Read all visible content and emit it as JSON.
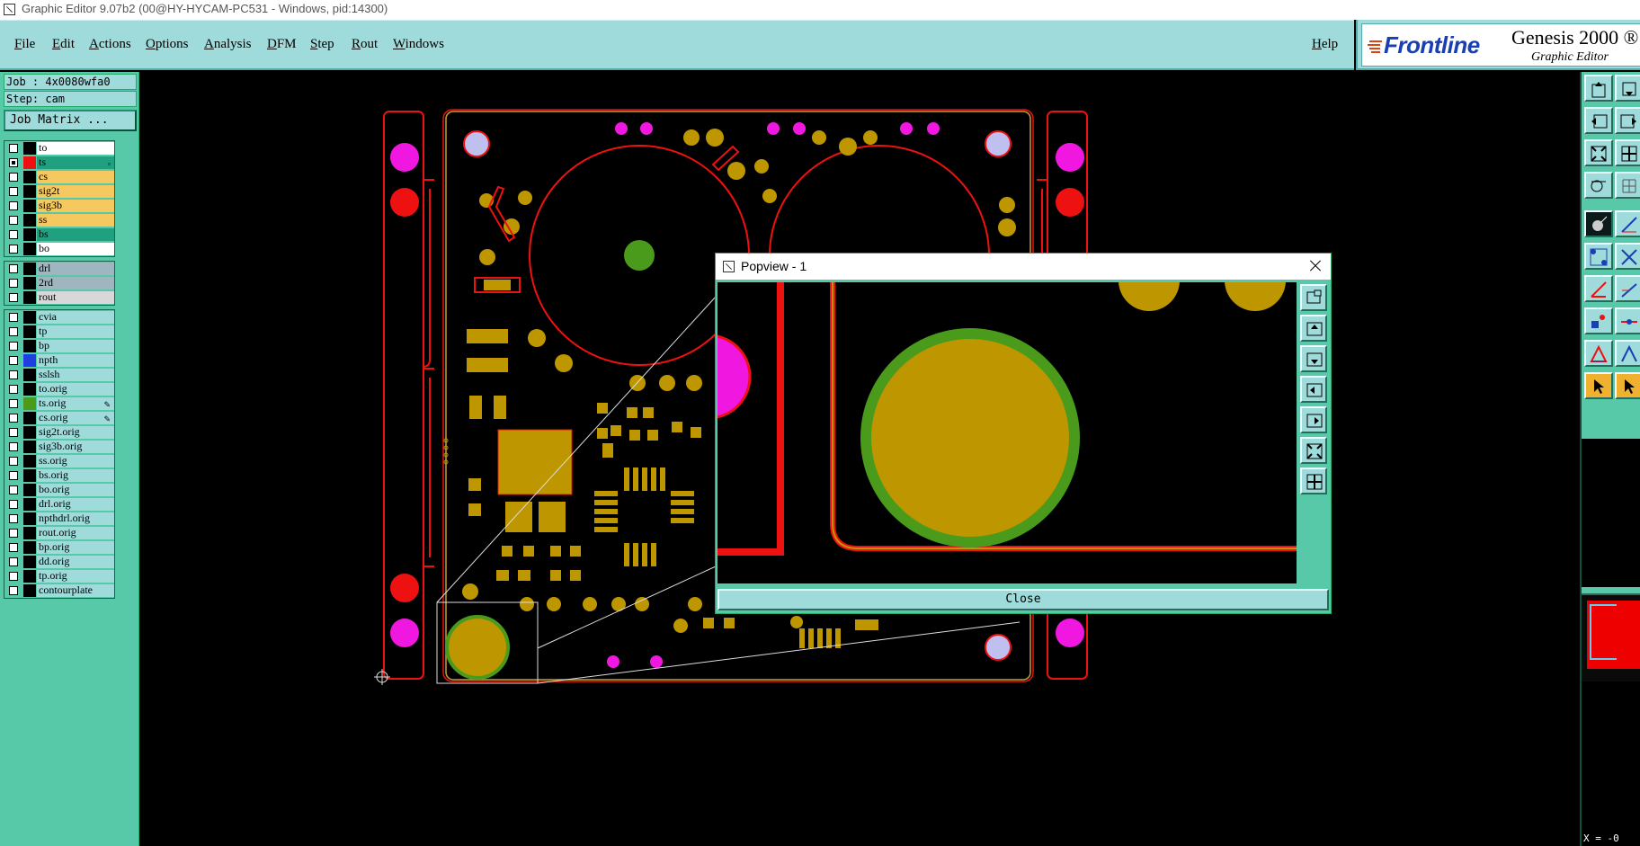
{
  "window": {
    "title": "Graphic Editor 9.07b2 (00@HY-HYCAM-PC531 - Windows, pid:14300)"
  },
  "menubar": {
    "items": [
      "File",
      "Edit",
      "Actions",
      "Options",
      "Analysis",
      "DFM",
      "Step",
      "Rout",
      "Windows"
    ],
    "help": "Help"
  },
  "brand": {
    "logo": "Frontline",
    "product": "Genesis 2000 ®",
    "subtitle": "Graphic Editor"
  },
  "job": {
    "job_line": "Job : 4x0080wfa0",
    "step_line": "Step: cam",
    "matrix_button": "Job Matrix ..."
  },
  "layers": {
    "group1": [
      {
        "name": "to",
        "color": "#ffffff",
        "swatch": "#000000",
        "checked": false
      },
      {
        "name": "ts",
        "color": "#21a080",
        "swatch": "#ee1111",
        "checked": true,
        "indicator": "▫"
      },
      {
        "name": "cs",
        "color": "#f6c860",
        "swatch": "#000000",
        "checked": false
      },
      {
        "name": "sig2t",
        "color": "#f6c860",
        "swatch": "#000000",
        "checked": false
      },
      {
        "name": "sig3b",
        "color": "#f6c860",
        "swatch": "#000000",
        "checked": false
      },
      {
        "name": "ss",
        "color": "#f6c860",
        "swatch": "#000000",
        "checked": false
      },
      {
        "name": "bs",
        "color": "#21a080",
        "swatch": "#000000",
        "checked": false
      },
      {
        "name": "bo",
        "color": "#ffffff",
        "swatch": "#000000",
        "checked": false
      }
    ],
    "group2": [
      {
        "name": "drl",
        "color": "#9fb5bf",
        "swatch": "#000000",
        "checked": false
      },
      {
        "name": "2rd",
        "color": "#9fb5bf",
        "swatch": "#000000",
        "checked": false
      },
      {
        "name": "rout",
        "color": "#d8d8d8",
        "swatch": "#000000",
        "checked": false
      }
    ],
    "group3": [
      {
        "name": "cvia",
        "color": "#9fdbdb",
        "swatch": "#000000",
        "checked": false
      },
      {
        "name": "tp",
        "color": "#9fdbdb",
        "swatch": "#000000",
        "checked": false
      },
      {
        "name": "bp",
        "color": "#9fdbdb",
        "swatch": "#000000",
        "checked": false
      },
      {
        "name": "npth",
        "color": "#9fdbdb",
        "swatch": "#1f3fe0",
        "checked": false
      },
      {
        "name": "sslsh",
        "color": "#9fdbdb",
        "swatch": "#000000",
        "checked": false
      },
      {
        "name": "to.orig",
        "color": "#9fdbdb",
        "swatch": "#000000",
        "checked": false
      },
      {
        "name": "ts.orig",
        "color": "#9fdbdb",
        "swatch": "#4a9a1c",
        "checked": false,
        "indicator": "✎"
      },
      {
        "name": "cs.orig",
        "color": "#9fdbdb",
        "swatch": "#000000",
        "checked": false,
        "indicator": "✎"
      },
      {
        "name": "sig2t.orig",
        "color": "#9fdbdb",
        "swatch": "#000000",
        "checked": false
      },
      {
        "name": "sig3b.orig",
        "color": "#9fdbdb",
        "swatch": "#000000",
        "checked": false
      },
      {
        "name": "ss.orig",
        "color": "#9fdbdb",
        "swatch": "#000000",
        "checked": false
      },
      {
        "name": "bs.orig",
        "color": "#9fdbdb",
        "swatch": "#000000",
        "checked": false
      },
      {
        "name": "bo.orig",
        "color": "#9fdbdb",
        "swatch": "#000000",
        "checked": false
      },
      {
        "name": "drl.orig",
        "color": "#9fdbdb",
        "swatch": "#000000",
        "checked": false
      },
      {
        "name": "npthdrl.orig",
        "color": "#9fdbdb",
        "swatch": "#000000",
        "checked": false
      },
      {
        "name": "rout.orig",
        "color": "#9fdbdb",
        "swatch": "#000000",
        "checked": false
      },
      {
        "name": "bp.orig",
        "color": "#9fdbdb",
        "swatch": "#000000",
        "checked": false
      },
      {
        "name": "dd.orig",
        "color": "#9fdbdb",
        "swatch": "#000000",
        "checked": false
      },
      {
        "name": "tp.orig",
        "color": "#9fdbdb",
        "swatch": "#000000",
        "checked": false
      },
      {
        "name": "contourplate",
        "color": "#9fdbdb",
        "swatch": "#000000",
        "checked": false
      }
    ]
  },
  "popview": {
    "title": "Popview - 1",
    "close_label": "Close"
  },
  "status": {
    "coord": "X = -0"
  },
  "colors": {
    "panel": "#58c9a8",
    "menubar": "#9fdbdb",
    "copper": "#be9600",
    "mask_green": "#4a9a1c",
    "trace_red": "#ee1111",
    "npth_magenta": "#f018e0"
  }
}
